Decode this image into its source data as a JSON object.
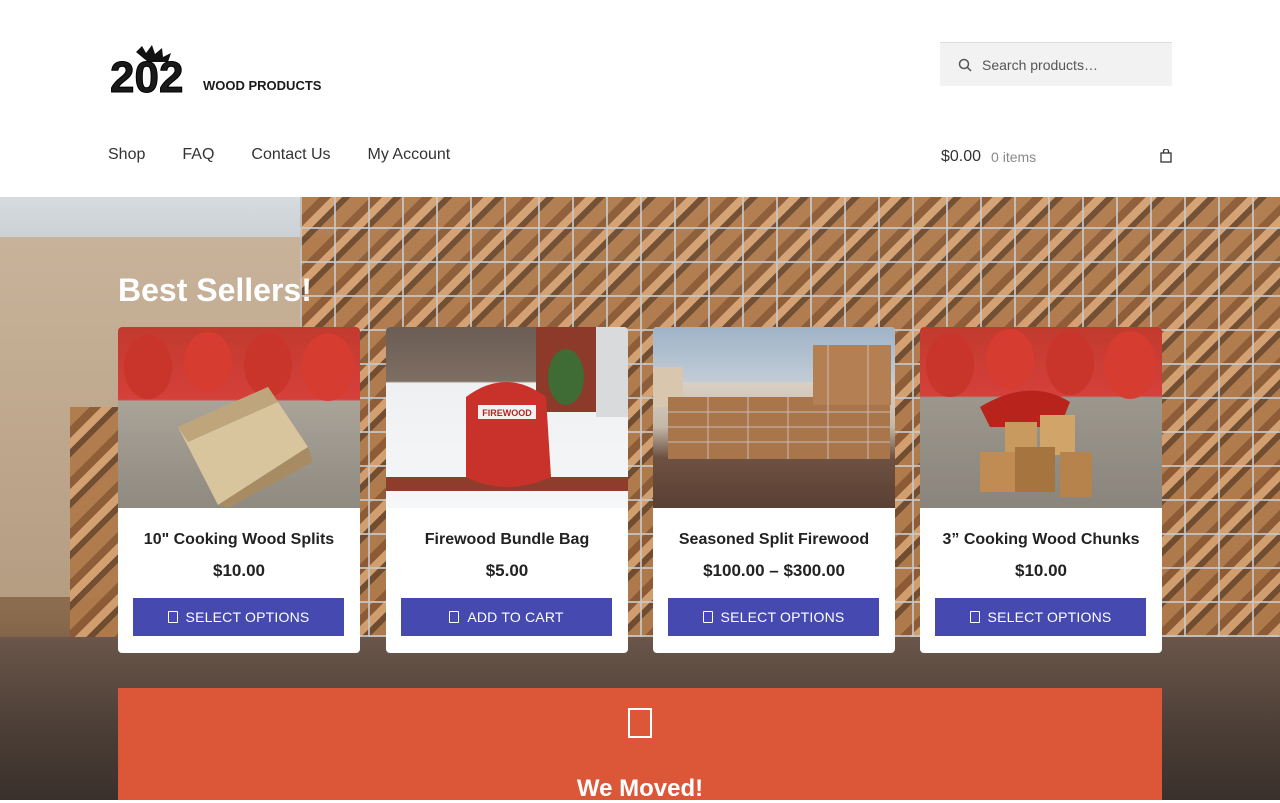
{
  "logo": {
    "number": "202",
    "text": "WOOD PRODUCTS"
  },
  "search": {
    "placeholder": "Search products…",
    "icon": "search-icon"
  },
  "nav": {
    "items": [
      "Shop",
      "FAQ",
      "Contact Us",
      "My Account"
    ]
  },
  "cart": {
    "total": "$0.00",
    "items": "0 items",
    "icon": "shopping-bag-icon"
  },
  "hero": {
    "title": "Best Sellers!"
  },
  "products": [
    {
      "name": "10\" Cooking Wood Splits",
      "price": "$10.00",
      "button": "SELECT OPTIONS"
    },
    {
      "name": "Firewood Bundle Bag",
      "price": "$5.00",
      "button": "ADD TO CART",
      "bag_label": "FIREWOOD"
    },
    {
      "name": "Seasoned Split Firewood",
      "price": "$100.00 – $300.00",
      "button": "SELECT OPTIONS"
    },
    {
      "name": "3” Cooking Wood Chunks",
      "price": "$10.00",
      "button": "SELECT OPTIONS"
    }
  ],
  "notice": {
    "title": "We Moved!",
    "icon": "truck-icon"
  },
  "colors": {
    "accent": "#4549b0",
    "notice": "#dc5638"
  }
}
